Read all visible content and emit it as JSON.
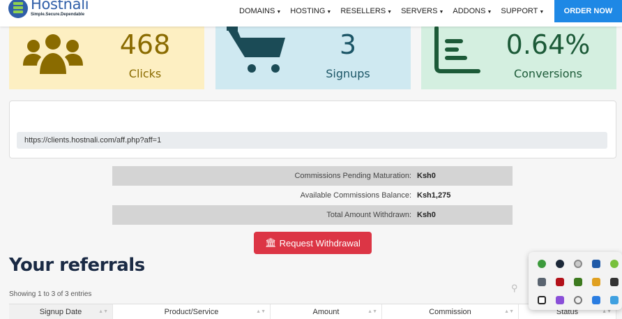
{
  "brand": {
    "name": "Hostnali",
    "tagline": "Simple.Secure.Dependable"
  },
  "nav": {
    "items": [
      "DOMAINS",
      "HOSTING",
      "RESELLERS",
      "SERVERS",
      "ADDONS",
      "SUPPORT"
    ],
    "order_label": "ORDER NOW"
  },
  "stats": {
    "clicks": {
      "value": "468",
      "label": "Clicks"
    },
    "signups": {
      "value": "3",
      "label": "Signups"
    },
    "conversions": {
      "value": "0.64%",
      "label": "Conversions"
    }
  },
  "referral_link": "https://clients.hostnali.com/aff.php?aff=1",
  "commissions": [
    {
      "label": "Commissions Pending Maturation:",
      "value": "Ksh0"
    },
    {
      "label": "Available Commissions Balance:",
      "value": "Ksh1,275"
    },
    {
      "label": "Total Amount Withdrawn:",
      "value": "Ksh0"
    }
  ],
  "withdraw_label": "Request Withdrawal",
  "referrals": {
    "title": "Your referrals",
    "showing": "Showing 1 to 3 of 3 entries",
    "columns": [
      "Signup Date",
      "Product/Service",
      "Amount",
      "Commission",
      "Status"
    ]
  },
  "colors": {
    "clicks_bg": "#fdefc2",
    "signups_bg": "#cfe9f1",
    "conversions_bg": "#d4efe0",
    "order_btn": "#1e88e5",
    "withdraw_btn": "#dc3545"
  },
  "tray_icons": [
    "green-app-icon",
    "steam-icon",
    "chrome-like-icon",
    "k-app-icon",
    "utorrent-icon",
    "monitor-icon",
    "red-app-icon",
    "nvidia-icon",
    "color-palette-icon",
    "dark-app-icon",
    "notion-icon",
    "pen-icon",
    "target-icon",
    "vpn-shield-icon",
    "blue-grid-icon"
  ]
}
